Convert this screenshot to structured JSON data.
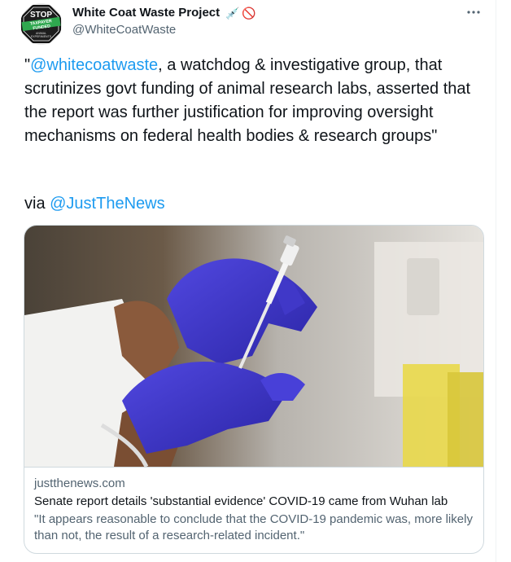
{
  "author": {
    "name": "White Coat Waste Project",
    "handle": "@WhiteCoatWaste",
    "name_emojis": [
      "💉",
      "🚫"
    ],
    "avatar_text": [
      "STOP",
      "TAXPAYER",
      "FUNDED",
      "ANIMAL",
      "EXPERIMENTS"
    ]
  },
  "more_icon": "more-horizontal-icon",
  "tweet": {
    "quote_open": "\"",
    "mention_1": "@whitecoatwaste",
    "body": ", a watchdog & investigative group, that scrutinizes govt funding of animal research labs, asserted that the report was further justification for improving oversight mechanisms on federal health bodies & research groups\"",
    "via_label": "via ",
    "mention_2": "@JustTheNews"
  },
  "card": {
    "domain": "justthenews.com",
    "title": "Senate report details 'substantial evidence' COVID-19 came from Wuhan lab",
    "description": "\"It appears reasonable to conclude that the COVID-19 pandemic was, more likely than not, the result of a research-related incident.\""
  },
  "colors": {
    "link": "#1d9bf0",
    "text": "#0f1419",
    "secondary": "#536471",
    "border": "#cfd9de",
    "glove": "#3b34c8"
  }
}
